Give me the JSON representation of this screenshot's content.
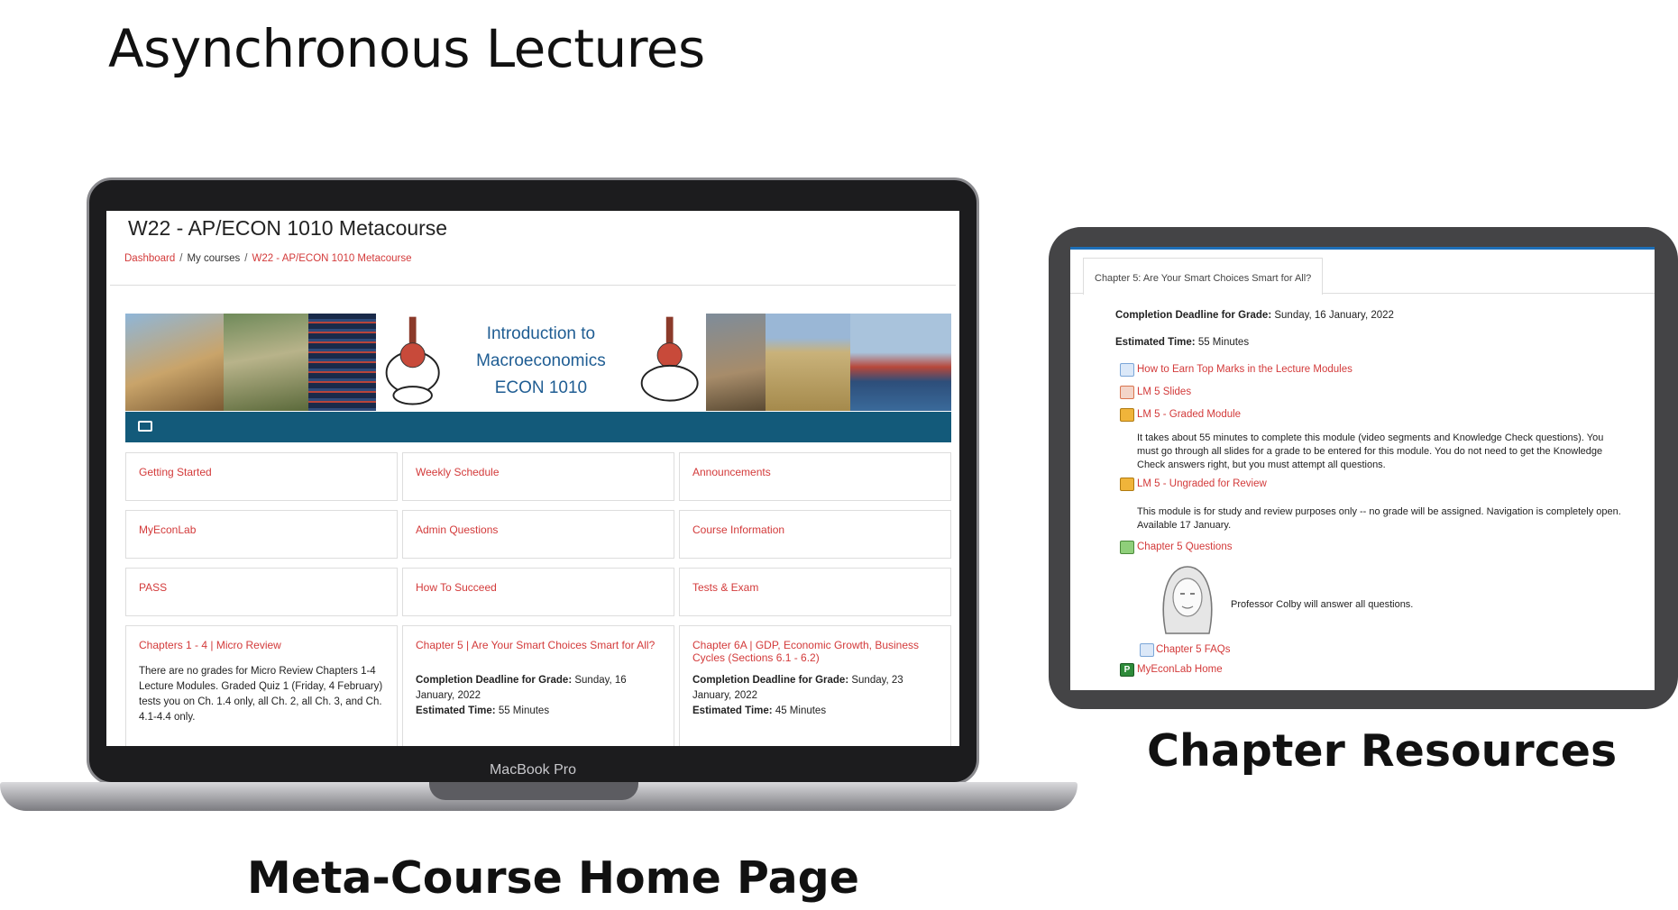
{
  "slide": {
    "title": "Asynchronous Lectures",
    "laptop_caption": "Meta-Course Home Page",
    "tablet_caption": "Chapter Resources",
    "laptop_model": "MacBook Pro"
  },
  "course": {
    "title": "W22 - AP/ECON 1010 Metacourse",
    "breadcrumb": [
      "Dashboard",
      "My courses",
      "W22 - AP/ECON 1010 Metacourse"
    ],
    "banner": {
      "line1": "Introduction to",
      "line2": "Macroeconomics",
      "line3": "ECON 1010"
    },
    "tiles": [
      {
        "label": "Getting Started"
      },
      {
        "label": "Weekly Schedule"
      },
      {
        "label": "Announcements"
      },
      {
        "label": "MyEconLab"
      },
      {
        "label": "Admin Questions"
      },
      {
        "label": "Course Information"
      },
      {
        "label": "PASS"
      },
      {
        "label": "How To Succeed"
      },
      {
        "label": "Tests & Exam"
      },
      {
        "label": "Chapters 1 - 4 | Micro Review",
        "body": "There are no grades for Micro Review Chapters 1-4 Lecture Modules. Graded Quiz 1 (Friday, 4 February) tests you on Ch. 1.4 only, all Ch. 2, all Ch. 3, and Ch. 4.1-4.4 only."
      },
      {
        "label": "Chapter 5 | Are Your Smart Choices Smart for All?",
        "deadline_label": "Completion Deadline for Grade:",
        "deadline": " Sunday, 16 January, 2022",
        "time_label": "Estimated Time:",
        "time": " 55 Minutes"
      },
      {
        "label": "Chapter 6A | GDP, Economic Growth, Business Cycles (Sections 6.1 - 6.2)",
        "deadline_label": "Completion Deadline for Grade:",
        "deadline": " Sunday, 23 January, 2022",
        "time_label": "Estimated Time:",
        "time": " 45 Minutes"
      }
    ]
  },
  "chapter": {
    "tab": "Chapter 5:  Are Your Smart Choices Smart for All?",
    "deadline_label": "Completion Deadline for Grade:",
    "deadline": " Sunday, 16 January, 2022",
    "time_label": "Estimated Time:",
    "time": " 55 Minutes",
    "link_top_marks": "How to Earn Top Marks in the Lecture Modules",
    "link_slides": "LM 5 Slides",
    "link_graded": "LM 5 - Graded Module",
    "graded_desc": "It takes about 55 minutes to complete this module (video segments and Knowledge Check questions). You must go through all slides for a grade to be entered for this module. You do not need to get the Knowledge Check answers right, but you must attempt all questions.",
    "link_ungraded": "LM 5 - Ungraded for Review",
    "ungraded_desc": "This module is for study and review purposes only -- no grade will be assigned. Navigation is completely open. Available 17 January.",
    "link_questions": "Chapter 5 Questions",
    "professor_note": "Professor Colby will answer all questions.",
    "link_faqs": "Chapter 5 FAQs",
    "link_myeconlab": "MyEconLab Home",
    "myeconlab_letter": "P"
  }
}
